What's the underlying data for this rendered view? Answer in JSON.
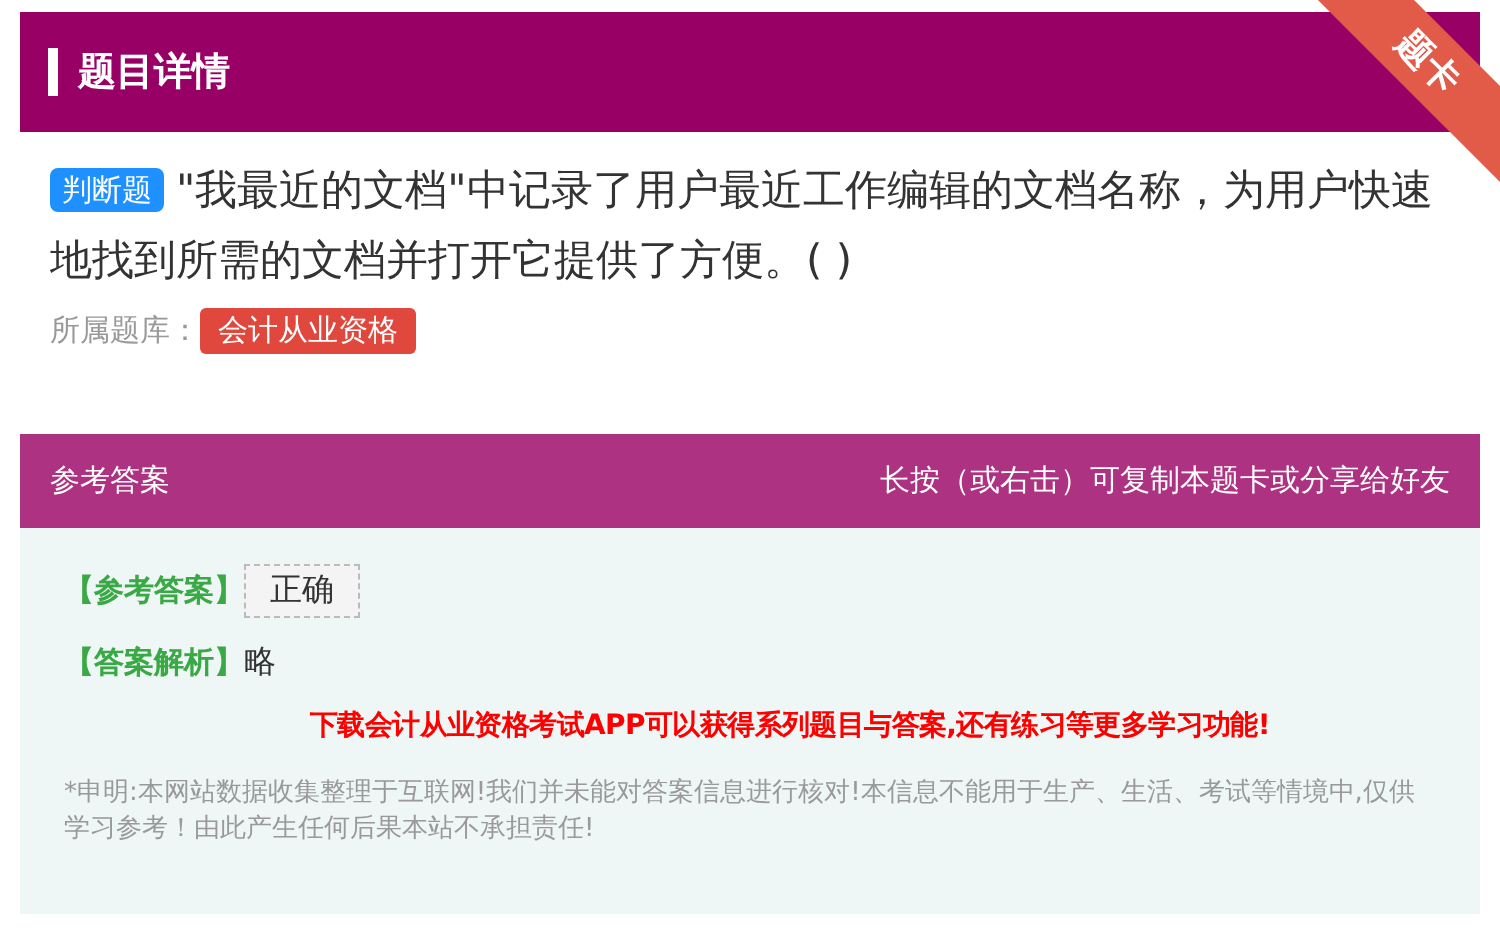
{
  "header": {
    "title": "题目详情",
    "corner_tag": "题卡"
  },
  "question": {
    "type_badge": "判断题",
    "text": "\"我最近的文档\"中记录了用户最近工作编辑的文档名称，为用户快速地找到所需的文档并打开它提供了方便。( )"
  },
  "library": {
    "label": "所属题库：",
    "tag": "会计从业资格"
  },
  "answer_panel": {
    "title": "参考答案",
    "hint": "长按（或右击）可复制本题卡或分享给好友",
    "answer_label": "【参考答案】",
    "answer": "正确",
    "analysis_label": "【答案解析】",
    "analysis": "略",
    "promo": "下载会计从业资格考试APP可以获得系列题目与答案,还有练习等更多学习功能!",
    "disclaimer": "*申明:本网站数据收集整理于互联网!我们并未能对答案信息进行核对!本信息不能用于生产、生活、考试等情境中,仅供学习参考！由此产生任何后果本站不承担责任!"
  }
}
